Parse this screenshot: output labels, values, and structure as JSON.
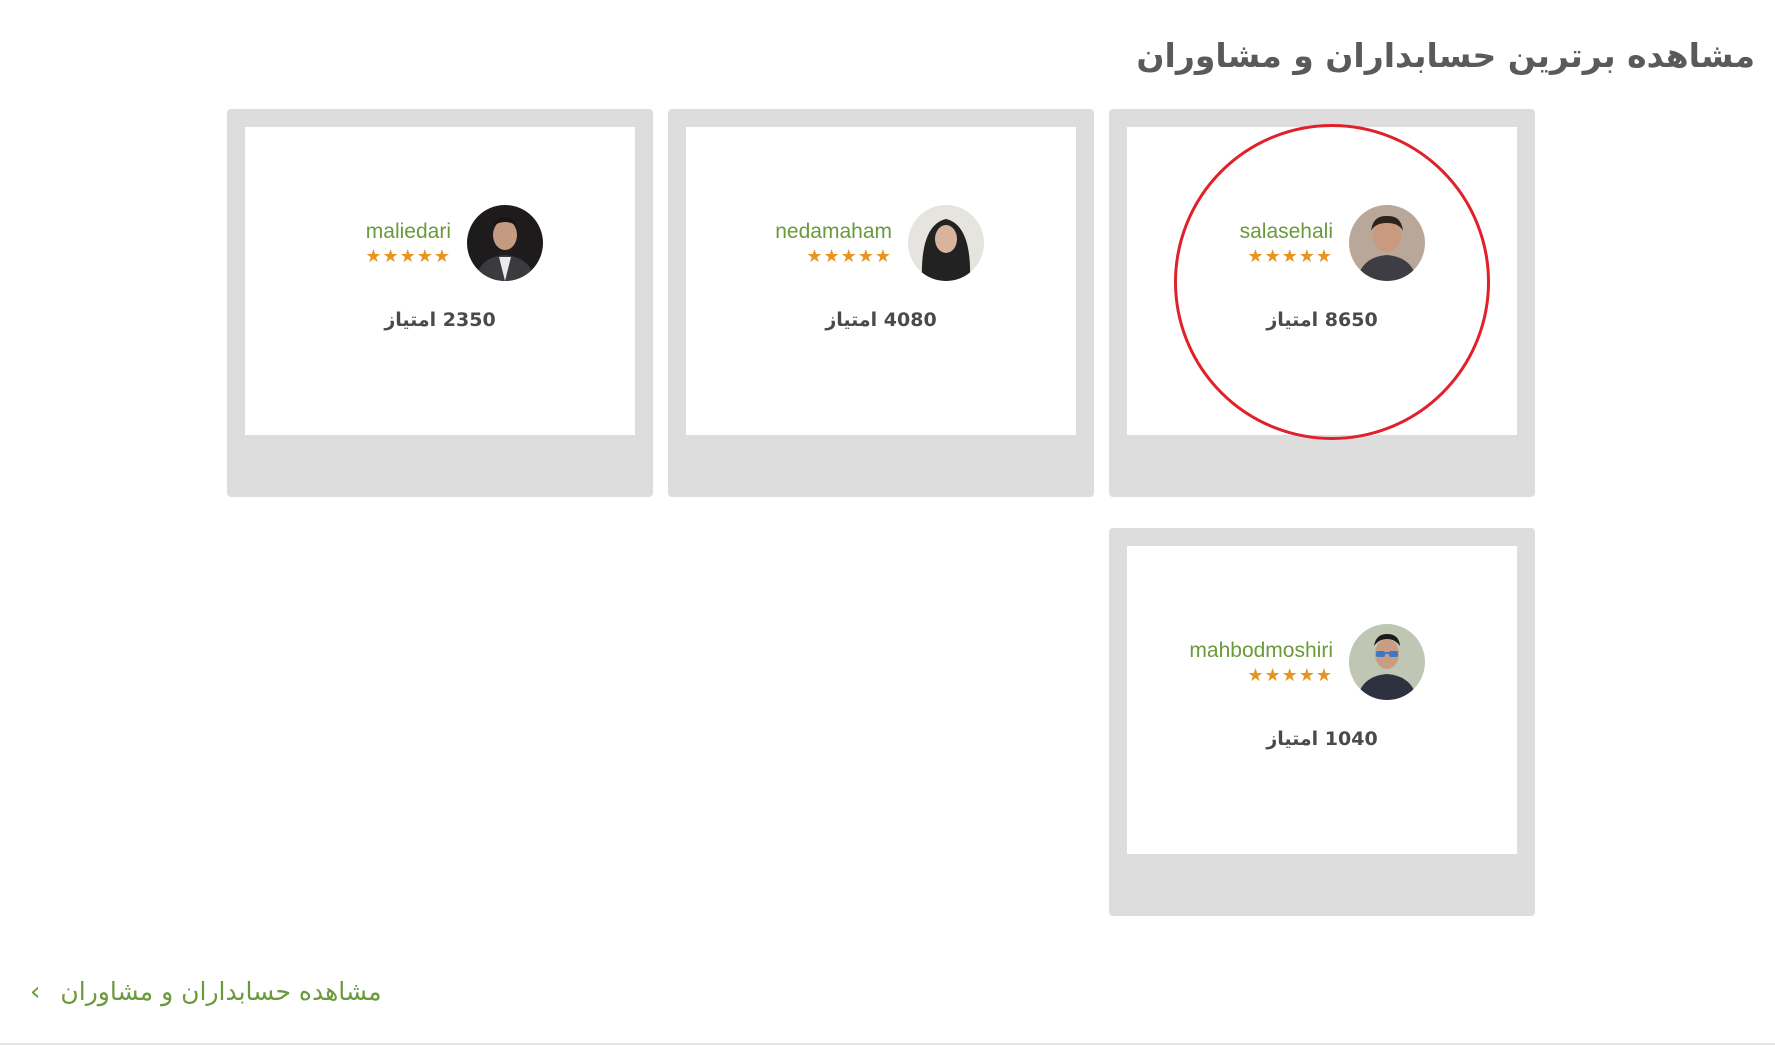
{
  "section": {
    "title": "مشاهده برترین حسابداران و مشاوران"
  },
  "advisors": [
    {
      "username": "salasehali",
      "stars": "★★★★★",
      "rating": 5,
      "points": "8650 امتیاز",
      "highlighted": true
    },
    {
      "username": "nedamaham",
      "stars": "★★★★★",
      "rating": 5,
      "points": "4080 امتیاز",
      "highlighted": false
    },
    {
      "username": "maliedari",
      "stars": "★★★★★",
      "rating": 5,
      "points": "2350 امتیاز",
      "highlighted": false
    },
    {
      "username": "mahbodmoshiri",
      "stars": "★★★★★",
      "rating": 5,
      "points": "1040 امتیاز",
      "highlighted": false
    }
  ],
  "footer": {
    "view_all_label": "مشاهده حسابداران و مشاوران",
    "chevron_icon": "chevron-left-icon"
  },
  "colors": {
    "accent_green": "#6a9a3a",
    "star_orange": "#e89520",
    "card_frame": "#dddddd",
    "highlight_red": "#e0202a"
  }
}
